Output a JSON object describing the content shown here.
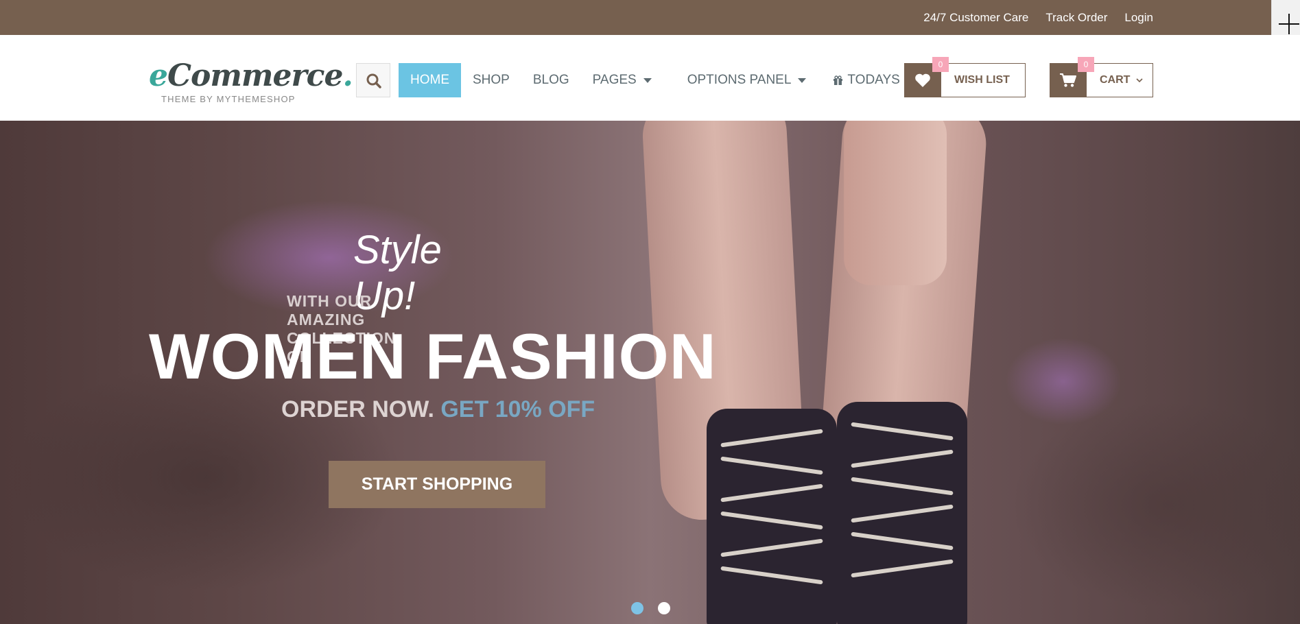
{
  "topbar": {
    "links": [
      "24/7 Customer Care",
      "Track Order",
      "Login"
    ]
  },
  "header": {
    "logo": {
      "title_accent": "e",
      "title_rest": "Commerce",
      "title_dot": ".",
      "subtitle": "THEME BY MYTHEMESHOP"
    },
    "nav": [
      {
        "label": "HOME",
        "active": true
      },
      {
        "label": "SHOP"
      },
      {
        "label": "BLOG"
      },
      {
        "label": "PAGES",
        "dropdown": true
      },
      {
        "label": "OPTIONS PANEL",
        "dropdown": true
      },
      {
        "label": "TODAYS OFFER",
        "icon": "gift-icon"
      }
    ],
    "wishlist": {
      "label": "WISH LIST",
      "count": "0",
      "icon": "heart-icon"
    },
    "cart": {
      "label": "CART",
      "count": "0",
      "icon": "cart-icon"
    }
  },
  "hero": {
    "script_title": "Style Up!",
    "subtitle": "WITH OUR AMAZING COLLECTION OF",
    "headline": "WOMEN FASHION",
    "order_text": "ORDER NOW.",
    "offer_text": "GET 10% OFF",
    "cta": "START SHOPPING",
    "slides": 2,
    "active_slide": 1
  },
  "colors": {
    "brand_brown": "#76604f",
    "nav_active": "#6bc4e3",
    "badge_pink": "#f7a6b8",
    "offer_blue": "#79a7c3"
  }
}
